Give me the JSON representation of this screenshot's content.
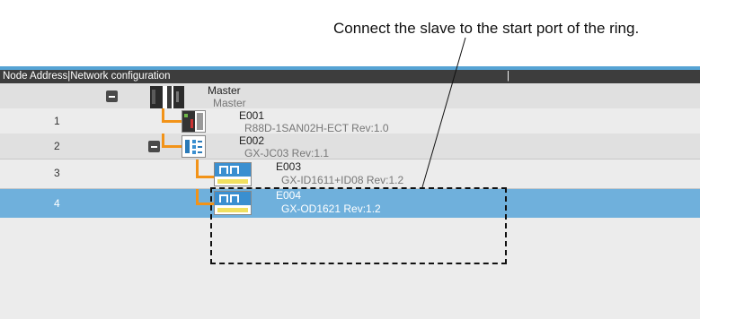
{
  "annotation": "Connect the slave to the start port of the ring.",
  "header": {
    "node_address": "Node Address",
    "network_configuration": "Network configuration",
    "separator": "|"
  },
  "nodes": [
    {
      "address": "",
      "name": "Master",
      "model": "Master",
      "icon": "plc-master-icon"
    },
    {
      "address": "1",
      "name": "E001",
      "model": "R88D-1SAN02H-ECT Rev:1.0",
      "icon": "servo-drive-icon"
    },
    {
      "address": "2",
      "name": "E002",
      "model": "GX-JC03 Rev:1.1",
      "icon": "junction-slave-icon"
    },
    {
      "address": "3",
      "name": "E003",
      "model": "GX-ID1611+ID08 Rev:1.2",
      "icon": "digital-io-icon"
    },
    {
      "address": "4",
      "name": "E004",
      "model": "GX-OD1621 Rev:1.2",
      "icon": "digital-io-icon"
    }
  ],
  "colors": {
    "header_bg": "#3d3d3d",
    "accent_line": "#56a3d4",
    "selected_row": "#6fb0dc",
    "connector": "#f29318"
  }
}
